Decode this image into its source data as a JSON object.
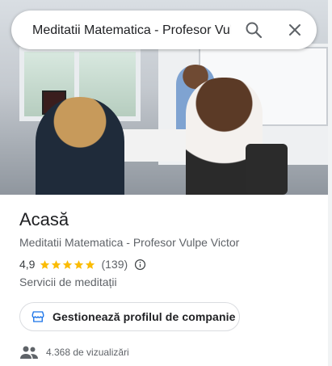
{
  "search": {
    "query": "Meditatii Matematica - Profesor Vulpe",
    "icons": {
      "search": "search-icon",
      "close": "close-icon"
    }
  },
  "hero": {
    "description_icon": "photo"
  },
  "place": {
    "title": "Acasă",
    "subtitle": "Meditatii Matematica - Profesor Vulpe Victor",
    "rating": "4,9",
    "stars": 5,
    "reviews": "(139)",
    "category": "Servicii de meditații"
  },
  "actions": {
    "manage_label": "Gestionează profilul de companie"
  },
  "stats": {
    "views": "4.368 de vizualizări"
  },
  "colors": {
    "star": "#fbbc04",
    "text_primary": "#202124",
    "text_secondary": "#5f6368",
    "accent": "#1a73e8"
  }
}
